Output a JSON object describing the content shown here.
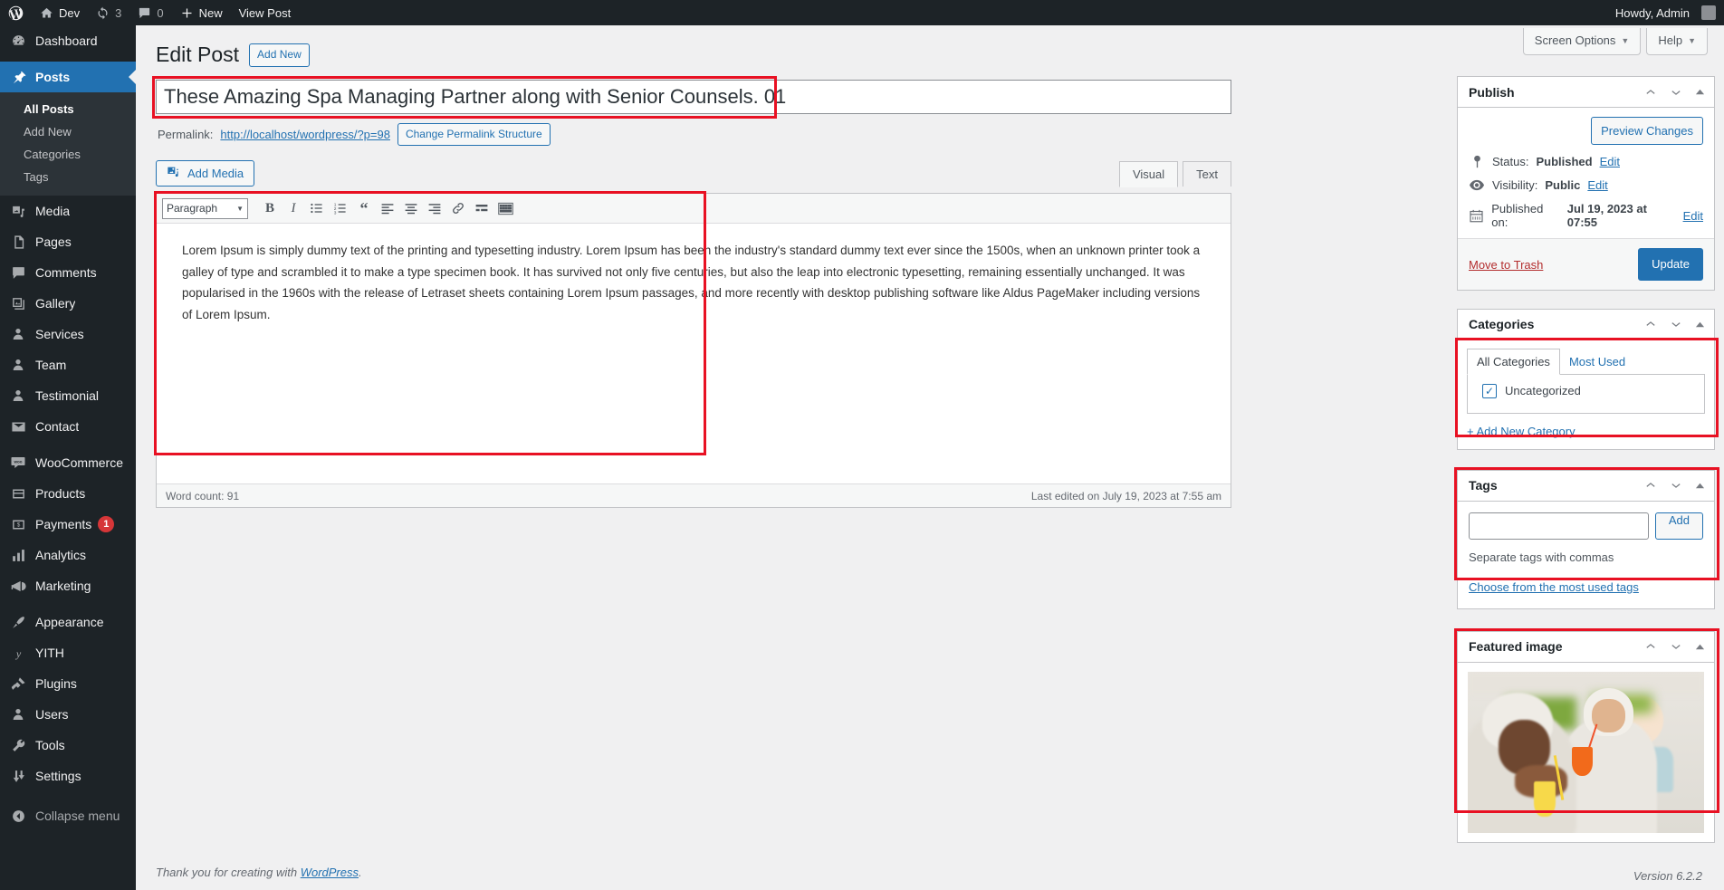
{
  "adminbar": {
    "logo_icon": "wordpress-logo-icon",
    "site_name": "Dev",
    "site_icon": "home-icon",
    "updates_icon": "updates-icon",
    "updates_count": "3",
    "comments_icon": "comment-bubble-icon",
    "comments_count": "0",
    "new_icon": "plus-icon",
    "new_label": "New",
    "view_post_label": "View Post",
    "howdy": "Howdy, Admin"
  },
  "sidebar": {
    "items": [
      {
        "label": "Dashboard",
        "icon": "dashboard-icon",
        "name": "dashboard"
      },
      {
        "label": "Posts",
        "icon": "pin-icon",
        "name": "posts",
        "current": true
      },
      {
        "label": "Media",
        "icon": "media-icon",
        "name": "media"
      },
      {
        "label": "Pages",
        "icon": "pages-icon",
        "name": "pages"
      },
      {
        "label": "Comments",
        "icon": "comment-bubble-icon",
        "name": "comments"
      },
      {
        "label": "Gallery",
        "icon": "gallery-icon",
        "name": "gallery"
      },
      {
        "label": "Services",
        "icon": "user-icon",
        "name": "services"
      },
      {
        "label": "Team",
        "icon": "user-icon",
        "name": "team"
      },
      {
        "label": "Testimonial",
        "icon": "user-icon",
        "name": "testimonial"
      },
      {
        "label": "Contact",
        "icon": "envelope-icon",
        "name": "contact"
      },
      {
        "label": "WooCommerce",
        "icon": "woocommerce-icon",
        "name": "woocommerce"
      },
      {
        "label": "Products",
        "icon": "products-icon",
        "name": "products"
      },
      {
        "label": "Payments",
        "icon": "payments-icon",
        "name": "payments",
        "badge": "1"
      },
      {
        "label": "Analytics",
        "icon": "bar-chart-icon",
        "name": "analytics"
      },
      {
        "label": "Marketing",
        "icon": "megaphone-icon",
        "name": "marketing"
      },
      {
        "label": "Appearance",
        "icon": "paintbrush-icon",
        "name": "appearance"
      },
      {
        "label": "YITH",
        "icon": "yith-icon",
        "name": "yith"
      },
      {
        "label": "Plugins",
        "icon": "plug-icon",
        "name": "plugins"
      },
      {
        "label": "Users",
        "icon": "user-icon",
        "name": "users"
      },
      {
        "label": "Tools",
        "icon": "wrench-icon",
        "name": "tools"
      },
      {
        "label": "Settings",
        "icon": "sliders-icon",
        "name": "settings"
      }
    ],
    "posts_submenu": [
      {
        "label": "All Posts",
        "current": true
      },
      {
        "label": "Add New",
        "current": false
      },
      {
        "label": "Categories",
        "current": false
      },
      {
        "label": "Tags",
        "current": false
      }
    ],
    "collapse_label": "Collapse menu",
    "collapse_icon": "collapse-arrow-icon"
  },
  "screen_meta": {
    "screen_options": "Screen Options",
    "help": "Help",
    "caret": "▼"
  },
  "main": {
    "page_title": "Edit Post",
    "add_new_label": "Add New",
    "title_value": "These Amazing Spa Managing Partner along with Senior Counsels. 01",
    "permalink_label": "Permalink:",
    "permalink_url": "http://localhost/wordpress/?p=98",
    "change_permalink_label": "Change Permalink Structure",
    "add_media_label": "Add Media",
    "add_media_icon": "add-media-icon",
    "tab_visual": "Visual",
    "tab_text": "Text",
    "format_select": "Paragraph",
    "format_caret": "▼",
    "toolbar_buttons": [
      {
        "name": "bold-icon",
        "glyph": "B"
      },
      {
        "name": "italic-icon",
        "glyph": "I"
      },
      {
        "name": "bulleted-list-icon",
        "glyph": ""
      },
      {
        "name": "numbered-list-icon",
        "glyph": ""
      },
      {
        "name": "blockquote-icon",
        "glyph": "“"
      },
      {
        "name": "align-left-icon",
        "glyph": ""
      },
      {
        "name": "align-center-icon",
        "glyph": ""
      },
      {
        "name": "align-right-icon",
        "glyph": ""
      },
      {
        "name": "insert-link-icon",
        "glyph": ""
      },
      {
        "name": "read-more-icon",
        "glyph": ""
      },
      {
        "name": "toolbar-toggle-icon",
        "glyph": ""
      }
    ],
    "body_text": "Lorem Ipsum is simply dummy text of the printing and typesetting industry. Lorem Ipsum has been the industry's standard dummy text ever since the 1500s, when an unknown printer took a galley of type and scrambled it to make a type specimen book. It has survived not only five centuries, but also the leap into electronic typesetting, remaining essentially unchanged. It was popularised in the 1960s with the release of Letraset sheets containing Lorem Ipsum passages, and more recently with desktop publishing software like Aldus PageMaker including versions of Lorem Ipsum.",
    "word_count": "Word count: 91",
    "last_edited": "Last edited on July 19, 2023 at 7:55 am",
    "footer_thanks_pre": "Thank you for creating with ",
    "footer_link": "WordPress",
    "footer_thanks_post": ".",
    "version": "Version 6.2.2"
  },
  "publish": {
    "title": "Publish",
    "preview_label": "Preview Changes",
    "status_label": "Status:",
    "status_value": "Published",
    "status_edit": "Edit",
    "status_icon": "pin-marker-icon",
    "visibility_label": "Visibility:",
    "visibility_value": "Public",
    "visibility_edit": "Edit",
    "visibility_icon": "eye-icon",
    "published_label": "Published on:",
    "published_value": "Jul 19, 2023 at 07:55",
    "published_edit": "Edit",
    "published_icon": "calendar-icon",
    "trash_label": "Move to Trash",
    "update_label": "Update"
  },
  "categories": {
    "title": "Categories",
    "tab_all": "All Categories",
    "tab_most_used": "Most Used",
    "items": [
      {
        "label": "Uncategorized",
        "checked": true
      }
    ],
    "add_new_label": "+ Add New Category"
  },
  "tags": {
    "title": "Tags",
    "input_value": "",
    "add_label": "Add",
    "help": "Separate tags with commas",
    "most_used_link": "Choose from the most used tags"
  },
  "featured_image": {
    "title": "Featured image",
    "image_alt": "Two women in white robes and towels drinking cocktails at a spa"
  },
  "panel_handles": {
    "up_icon": "chevron-up-icon",
    "down_icon": "chevron-down-icon",
    "toggle_icon": "panel-toggle-icon"
  },
  "colors": {
    "accent": "#2271b1",
    "admin_dark": "#1d2327",
    "highlight_red": "#e81123",
    "danger": "#d63638"
  }
}
